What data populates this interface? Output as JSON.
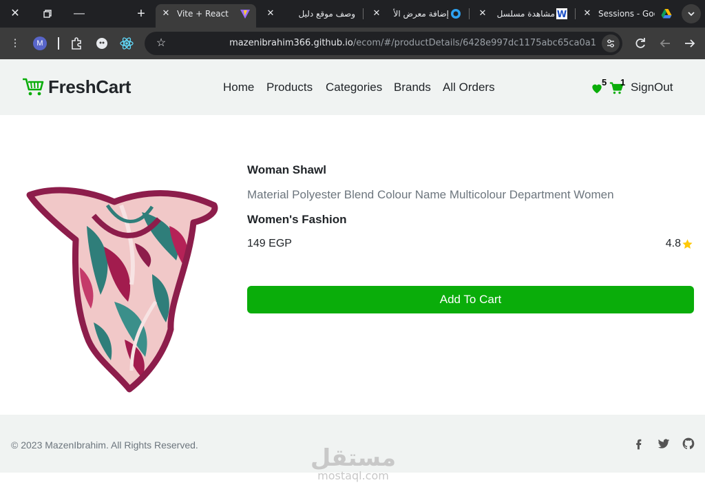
{
  "browser": {
    "tabs": [
      {
        "title": "Vite + React",
        "active": true
      },
      {
        "title": "وصف موقع دليل",
        "active": false
      },
      {
        "title": "إضافة معرض الأ",
        "active": false
      },
      {
        "title": "مشاهدة مسلسل",
        "active": false
      },
      {
        "title": "Sessions - Goog",
        "active": false
      }
    ],
    "url_host": "mazenibrahim366.github.io",
    "url_path": "/ecom/#/productDetails/6428e997dc1175abc65ca0a1",
    "profile_initial": "M",
    "colors": {
      "profile": "#5865c9",
      "tab_bg": "#3c3c3c"
    }
  },
  "navbar": {
    "brand": "FreshCart",
    "links": [
      "Home",
      "Products",
      "Categories",
      "Brands",
      "All Orders"
    ],
    "wishlist_count": "5",
    "cart_count": "1",
    "signout_label": "SignOut",
    "colors": {
      "accent": "#0aad0a",
      "bg": "#f0f3f2"
    }
  },
  "product": {
    "title": "Woman Shawl",
    "description": "Material Polyester Blend Colour Name Multicolour Department Women",
    "category": "Women's Fashion",
    "price": "149 EGP",
    "rating": "4.8",
    "add_to_cart_label": "Add To Cart",
    "colors": {
      "button": "#0aad0a",
      "star": "#ffc908"
    }
  },
  "footer": {
    "copyright": "© 2023 MazenIbrahim. All Rights Reserved.",
    "social": [
      "facebook-icon",
      "twitter-icon",
      "github-icon"
    ]
  },
  "watermark": {
    "arabic": "مستقل",
    "latin": "mostaql.com"
  }
}
